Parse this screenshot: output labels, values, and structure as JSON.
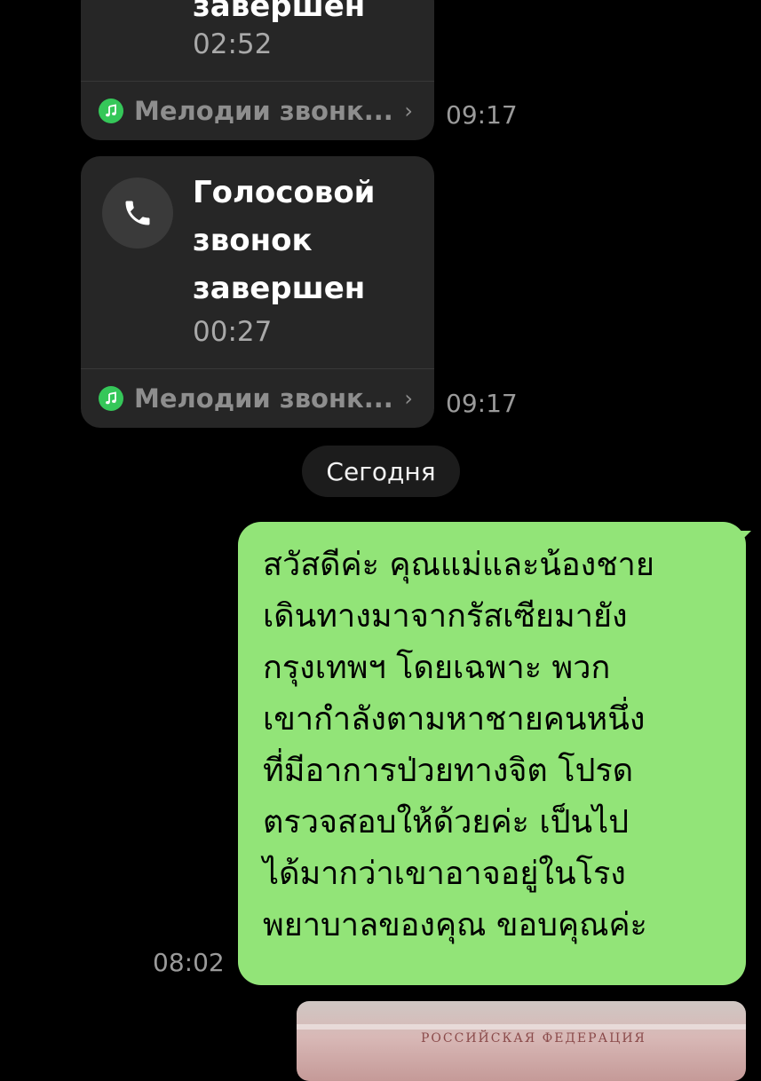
{
  "call_bubble_1": {
    "title_line_last": "завершен",
    "duration": "02:52",
    "footer_label": "Мелодии звонк...",
    "chevron": "›",
    "time": "09:17"
  },
  "call_bubble_2": {
    "title_lines": [
      "Голосовой",
      "звонок",
      "завершен"
    ],
    "duration": "00:27",
    "footer_label": "Мелодии звонк...",
    "chevron": "›",
    "time": "09:17"
  },
  "date_separator": "Сегодня",
  "outgoing_message": {
    "text": "สวัสดีค่ะ คุณแม่และน้องชาย\nเดินทางมาจากรัสเซียมายัง\nกรุงเทพฯ โดยเฉพาะ พวก\nเขากำลังตามหาชายคนหนึ่ง\nที่มีอาการป่วยทางจิต โปรด\nตรวจสอบให้ด้วยค่ะ เป็นไป\nได้มากว่าเขาอาจอยู่ในโรง\nพยาบาลของคุณ ขอบคุณค่ะ",
    "time": "08:02"
  },
  "photo_message": {
    "visible_text": "РОССИЙСКАЯ ФЕДЕРАЦИЯ"
  },
  "icons": {
    "call": "phone-icon",
    "footer": "music-note-icon"
  },
  "colors": {
    "background": "#000000",
    "incoming_bubble": "#262626",
    "outgoing_bubble": "#92e478",
    "music_icon": "#35c759"
  }
}
